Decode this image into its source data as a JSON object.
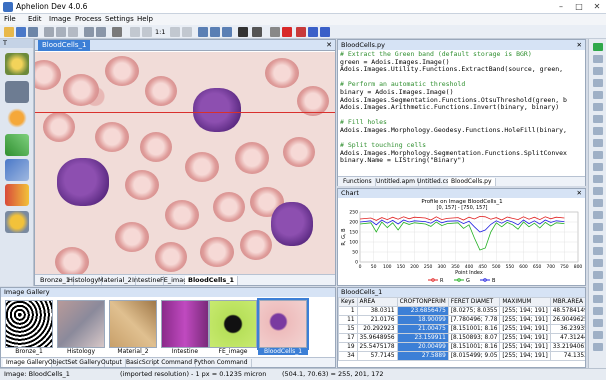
{
  "window": {
    "title": "Aphelion Dev 4.0.6"
  },
  "menu": [
    "File",
    "Edit",
    "Image",
    "Process",
    "Settings",
    "Help"
  ],
  "toolbar": {
    "zoom_label": "1:1"
  },
  "left_panel": {
    "header": "T"
  },
  "image_window": {
    "title": "BloodCells_1",
    "tabs": [
      "Bronze_1",
      "Histology",
      "Material_2",
      "Intestine",
      "FE_image",
      "BloodCells_1"
    ],
    "active_tab": "BloodCells_1"
  },
  "code_window": {
    "title": "BloodCells.py",
    "lines": [
      {
        "t": "# Extract the Green band (default storage is BGR)",
        "c": "cmt"
      },
      {
        "t": "green = Adois.Images.Image()",
        "c": ""
      },
      {
        "t": "Adois.Images.Utility.Functions.ExtractBand(source, green,",
        "c": ""
      },
      {
        "t": "",
        "c": ""
      },
      {
        "t": "# Perform an automatic threshold",
        "c": "cmt"
      },
      {
        "t": "binary = Adois.Images.Image()",
        "c": ""
      },
      {
        "t": "Adois.Images.Segmentation.Functions.OtsuThreshold(green, b",
        "c": ""
      },
      {
        "t": "Adois.Images.Arithmetic.Functions.Invert(binary, binary)",
        "c": ""
      },
      {
        "t": "",
        "c": ""
      },
      {
        "t": "# Fill holes",
        "c": "cmt"
      },
      {
        "t": "Adois.Images.Morphology.Geodesy.Functions.HoleFill(binary,",
        "c": ""
      },
      {
        "t": "",
        "c": ""
      },
      {
        "t": "# Split touching cells",
        "c": "cmt"
      },
      {
        "t": "Adois.Images.Morphology.Segmentation.Functions.SplitConvex",
        "c": ""
      },
      {
        "t": "binary.Name = LIString(\"Binary\")",
        "c": "strline"
      }
    ],
    "tabs": [
      "Functions",
      "Untitled.apm",
      "Untitled.cs",
      "BloodCells.py"
    ],
    "active_tab": "BloodCells.py"
  },
  "chart_window": {
    "title": "Chart",
    "chart_title": "Profile on Image BloodCells_1",
    "chart_subtitle": "[0, 157] - [750, 157]",
    "xlabel": "Point Index",
    "ylabel": "R, G, B",
    "legend": [
      "R",
      "G",
      "B"
    ]
  },
  "chart_data": {
    "type": "line",
    "title": "Profile on Image BloodCells_1",
    "subtitle": "[0, 157] - [750, 157]",
    "xlabel": "Point Index",
    "ylabel": "R, G, B",
    "xlim": [
      0,
      800
    ],
    "ylim": [
      0,
      250
    ],
    "xticks": [
      0,
      50,
      100,
      150,
      200,
      250,
      300,
      350,
      400,
      450,
      500,
      550,
      600,
      650,
      700,
      750,
      800
    ],
    "yticks": [
      0,
      50,
      100,
      150,
      200,
      250
    ],
    "legend_position": "bottom",
    "series": [
      {
        "name": "R",
        "color": "#e02020",
        "x": [
          0,
          40,
          60,
          80,
          100,
          120,
          140,
          160,
          180,
          200,
          240,
          260,
          280,
          300,
          320,
          360,
          380,
          400,
          420,
          440,
          460,
          480,
          500,
          520,
          540,
          560,
          580,
          600,
          620,
          640,
          660,
          680,
          700,
          720,
          750
        ],
        "y": [
          215,
          220,
          208,
          222,
          212,
          224,
          214,
          226,
          216,
          224,
          220,
          210,
          226,
          212,
          218,
          222,
          210,
          224,
          215,
          228,
          226,
          214,
          222,
          210,
          225,
          218,
          212,
          226,
          214,
          224,
          212,
          226,
          216,
          224,
          220
        ]
      },
      {
        "name": "G",
        "color": "#20b020",
        "x": [
          0,
          40,
          60,
          80,
          100,
          120,
          140,
          160,
          180,
          200,
          240,
          260,
          280,
          300,
          320,
          360,
          380,
          400,
          420,
          440,
          460,
          480,
          500,
          520,
          540,
          560,
          580,
          600,
          620,
          640,
          660,
          680,
          700,
          720,
          750
        ],
        "y": [
          190,
          196,
          150,
          200,
          172,
          196,
          160,
          198,
          188,
          196,
          190,
          178,
          200,
          182,
          192,
          196,
          168,
          186,
          120,
          60,
          70,
          150,
          196,
          176,
          198,
          186,
          164,
          200,
          176,
          194,
          170,
          198,
          180,
          196,
          192
        ]
      },
      {
        "name": "B",
        "color": "#2020e0",
        "x": [
          0,
          40,
          60,
          80,
          100,
          120,
          140,
          160,
          180,
          200,
          240,
          260,
          280,
          300,
          320,
          360,
          380,
          400,
          420,
          440,
          460,
          480,
          500,
          520,
          540,
          560,
          580,
          600,
          620,
          640,
          660,
          680,
          700,
          720,
          750
        ],
        "y": [
          200,
          206,
          186,
          210,
          194,
          208,
          190,
          210,
          200,
          206,
          202,
          194,
          210,
          196,
          204,
          206,
          192,
          204,
          176,
          150,
          160,
          188,
          206,
          194,
          208,
          200,
          186,
          210,
          192,
          206,
          190,
          210,
          198,
          206,
          202
        ]
      }
    ]
  },
  "gallery": {
    "title": "Image Gallery",
    "items": [
      "Bronze_1",
      "Histology",
      "Material_2",
      "Intestine",
      "FE_image",
      "BloodCells_1"
    ],
    "selected": "BloodCells_1",
    "tabs": [
      "Image Gallery",
      "ObjectSet Gallery",
      "Output",
      "BasicScript Command",
      "Python Command"
    ]
  },
  "table_window": {
    "title": "BloodCells_1",
    "columns": [
      "Keys",
      "AREA",
      "CROFTONPERIM",
      "FERET DIAMET",
      "MAXIMUM",
      "MBR.AREA",
      "MB"
    ],
    "rows": [
      [
        "1",
        "38.0311",
        "23.6856475",
        "[8.0275; 8.0355",
        "[255; 194; 191]",
        "48.5784149",
        ""
      ],
      [
        "11",
        "21.0176",
        "18.90099",
        "[7.780496; 7.78",
        "[255; 194; 191]",
        "26.9049625",
        ""
      ],
      [
        "15",
        "20.292923",
        "21.00475",
        "[8.151001; 8.16",
        "[255; 194; 191]",
        "36.23935",
        ""
      ],
      [
        "17",
        "35.9648956",
        "23.159911",
        "[8.150893; 8.07",
        "[255; 194; 191]",
        "47.31244",
        ""
      ],
      [
        "19",
        "25.5475178",
        "20.00499",
        "[8.151001; 8.16",
        "[255; 194; 191]",
        "33.2194061",
        ""
      ],
      [
        "34",
        "57.7145",
        "27.5889",
        "[8.015499; 9.05",
        "[255; 194; 191]",
        "74.1353",
        ""
      ]
    ]
  },
  "status": {
    "image": "Image: BloodCells_1",
    "resolution": "(imported resolution) - 1 px = 0.1235 micron",
    "pixel": "(504.1, 70.63) = 255, 201, 172"
  }
}
